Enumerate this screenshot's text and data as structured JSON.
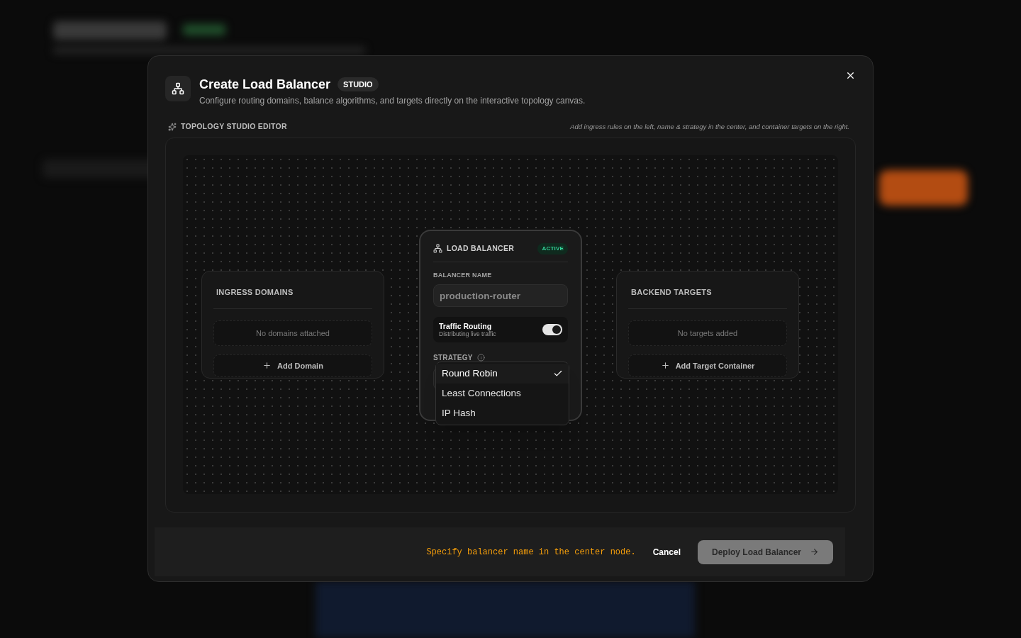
{
  "dialog": {
    "title": "Create Load Balancer",
    "badge": "STUDIO",
    "subtitle": "Configure routing domains, balance algorithms, and targets directly on the interactive topology canvas."
  },
  "editor": {
    "label": "TOPOLOGY STUDIO EDITOR",
    "hint": "Add ingress rules on the left, name & strategy in the center, and container targets on the right."
  },
  "ingress": {
    "title": "INGRESS DOMAINS",
    "empty": "No domains attached",
    "add": "Add Domain"
  },
  "balancer": {
    "title": "LOAD BALANCER",
    "status": "ACTIVE",
    "name_label": "BALANCER NAME",
    "name_placeholder": "production-router",
    "routing": {
      "title": "Traffic Routing",
      "subtitle": "Distributing live traffic",
      "on": true
    },
    "strategy_label": "STRATEGY",
    "dropdown_open": true,
    "strategy_options": [
      {
        "label": "Round Robin",
        "selected": true
      },
      {
        "label": "Least Connections",
        "selected": false
      },
      {
        "label": "IP Hash",
        "selected": false
      }
    ]
  },
  "targets": {
    "title": "BACKEND TARGETS",
    "empty": "No targets added",
    "add": "Add Target Container"
  },
  "footer": {
    "message": "Specify balancer name in the center node.",
    "cancel": "Cancel",
    "deploy": {
      "label": "Deploy Load Balancer",
      "disabled": true
    }
  }
}
